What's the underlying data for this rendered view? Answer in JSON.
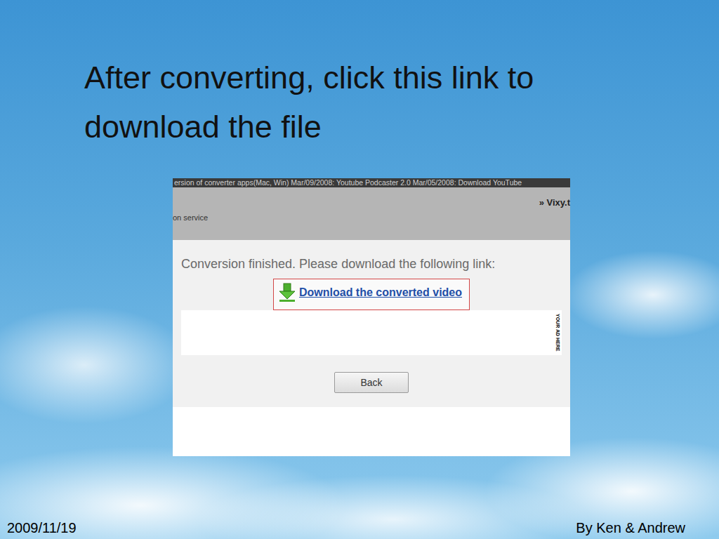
{
  "slide": {
    "title": "After converting, click this link to download the file",
    "date": "2009/11/19",
    "author": "By Ken & Andrew"
  },
  "screenshot": {
    "news_bar": "ersion of converter apps(Mac, Win)   Mar/09/2008: Youtube Podcaster 2.0   Mar/05/2008: Download YouTube",
    "site_link": "» Vixy.t",
    "service_label": "on service",
    "message": "Conversion finished. Please download the following link:",
    "download_link": "Download the converted video",
    "ad_label": "YOUR AD HERE",
    "buttons": [
      "Back"
    ]
  }
}
